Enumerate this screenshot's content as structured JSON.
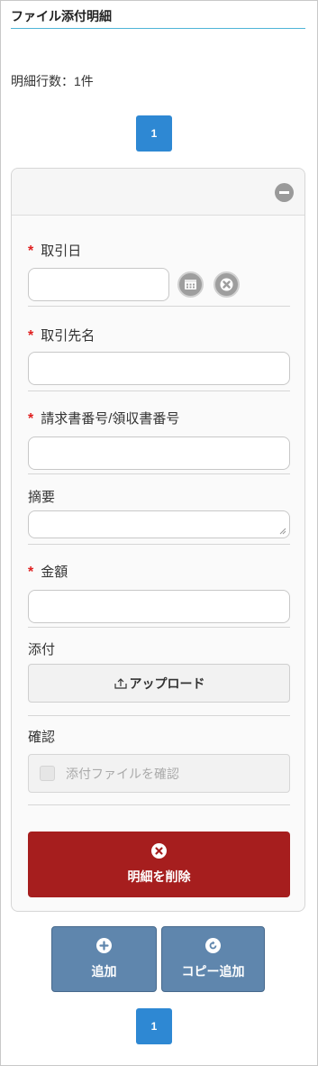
{
  "title": "ファイル添付明細",
  "row_count": {
    "label": "明細行数：",
    "value": "1件"
  },
  "pagination": {
    "pages": [
      "1"
    ]
  },
  "form": {
    "fields": [
      {
        "label": "取引日",
        "required": true,
        "type": "date"
      },
      {
        "label": "取引先名",
        "required": true,
        "type": "text"
      },
      {
        "label": "請求書番号/領収書番号",
        "required": true,
        "type": "text"
      },
      {
        "label": "摘要",
        "required": false,
        "type": "textarea"
      },
      {
        "label": "金額",
        "required": true,
        "type": "text"
      }
    ],
    "attachment": {
      "label": "添付",
      "upload_label": "アップロード"
    },
    "confirm": {
      "label": "確認",
      "checkbox_label": "添付ファイルを確認",
      "checked": false
    }
  },
  "buttons": {
    "delete": "明細を削除",
    "add": "追加",
    "copy_add": "コピー追加"
  },
  "colors": {
    "primary": "#2e88d3",
    "danger": "#a61e1e",
    "action": "#5f86ad",
    "required": "#e02020",
    "title_underline": "#4fb5d8"
  },
  "icons": {
    "date": "calendar-icon",
    "clear": "clear-circle-icon",
    "collapse": "minus-circle-icon",
    "upload": "upload-icon",
    "delete": "x-circle-icon",
    "add": "plus-circle-icon",
    "copy": "refresh-circle-icon"
  }
}
